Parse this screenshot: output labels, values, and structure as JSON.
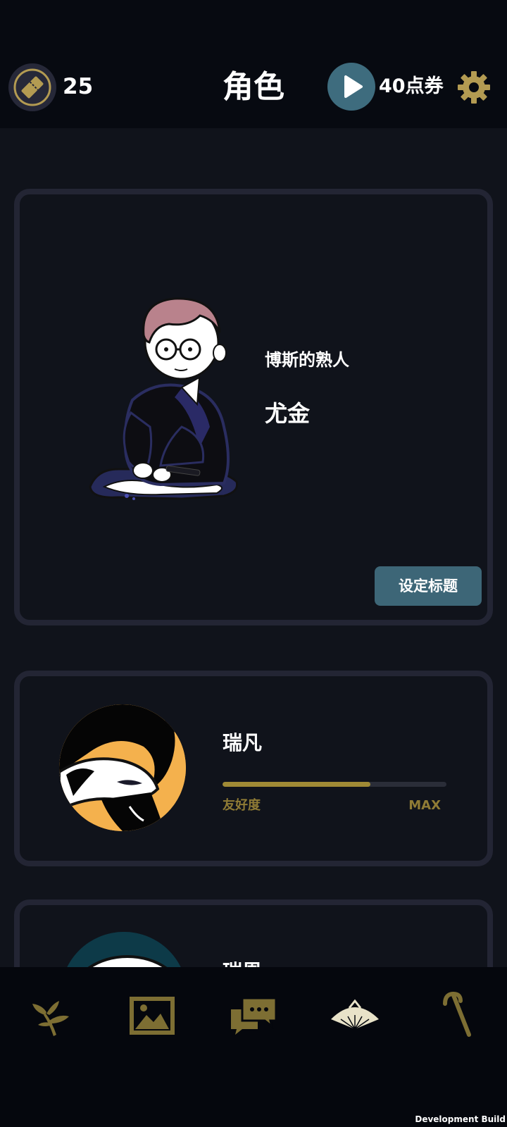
{
  "header": {
    "ticket_count": "25",
    "title": "角色",
    "coupon_label": "40点券",
    "icons": {
      "ticket": "ticket-icon",
      "play": "play-icon",
      "settings": "gear-icon"
    }
  },
  "featured_character": {
    "subtitle": "博斯的熟人",
    "name": "尤金",
    "set_title_button": "设定标题"
  },
  "characters": [
    {
      "name": "瑞凡",
      "friendship_label": "友好度",
      "friendship_value_label": "MAX",
      "friendship_progress": 0.66
    },
    {
      "name": "瑞恩"
    }
  ],
  "bottom_nav": {
    "items": [
      {
        "icon": "branch-icon"
      },
      {
        "icon": "gallery-icon"
      },
      {
        "icon": "chat-icon"
      },
      {
        "icon": "fan-icon"
      },
      {
        "icon": "cane-icon"
      }
    ]
  },
  "footer": {
    "build_label": "Development Build"
  },
  "colors": {
    "background": "#10131b",
    "header_background": "#070a11",
    "card_border": "#232534",
    "accent_teal": "#3d6677",
    "gold": "#8f7b35"
  }
}
